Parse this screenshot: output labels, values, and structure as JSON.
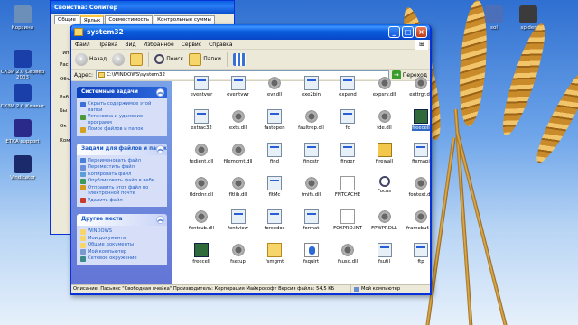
{
  "desktop": {
    "icons": [
      {
        "label": "Корзина",
        "icon": "recycle-bin-icon",
        "color": "#6b8fb9"
      },
      {
        "label": "СКЗИ 2.0 Сервер 2003",
        "icon": "app-icon",
        "color": "#1b3fa8"
      },
      {
        "label": "СКЗИ 2.0 Клиент",
        "icon": "app-icon",
        "color": "#1b3fa8"
      },
      {
        "label": "ЕТКА support",
        "icon": "app-icon",
        "color": "#2a2a8a"
      },
      {
        "label": "Vindicator",
        "icon": "app-icon",
        "color": "#1a2a6a"
      },
      {
        "label": "sol",
        "icon": "solitaire-icon",
        "color": "#4b6fb9"
      },
      {
        "label": "spider",
        "icon": "spider-icon",
        "color": "#3b3b3b"
      }
    ]
  },
  "props_window": {
    "title": "Свойства: Солитер",
    "tabs": [
      "Общие",
      "Ярлык",
      "Совместимость",
      "Контрольные суммы"
    ],
    "active_tab": 1,
    "labels": [
      "Тип",
      "Рас",
      "Объ",
      "Раб",
      "Бы",
      "Ок",
      "Ком"
    ]
  },
  "window": {
    "title": "system32",
    "menu": [
      "Файл",
      "Правка",
      "Вид",
      "Избранное",
      "Сервис",
      "Справка"
    ],
    "toolbar": {
      "back": "Назад",
      "search": "Поиск",
      "folders": "Папки"
    },
    "address_label": "Адрес:",
    "address_value": "C:\\WINDOWS\\system32",
    "go_label": "Переход"
  },
  "tasks": {
    "system": {
      "title": "Системные задачи",
      "items": [
        "Скрыть содержимое этой папки",
        "Установка и удаление программ",
        "Поиск файлов и папок"
      ]
    },
    "files": {
      "title": "Задачи для файлов и папок",
      "items": [
        "Переименовать файл",
        "Переместить файл",
        "Копировать файл",
        "Опубликовать файл в вебе",
        "Отправить этот файл по электронной почте",
        "Удалить файл"
      ]
    },
    "places": {
      "title": "Другие места",
      "items": [
        "WINDOWS",
        "Мои документы",
        "Общие документы",
        "Мой компьютер",
        "Сетевое окружение"
      ]
    }
  },
  "files": [
    {
      "name": "eventvwr",
      "icon": "exe"
    },
    {
      "name": "eventvwr",
      "icon": "exe"
    },
    {
      "name": "evr.dll",
      "icon": "gear"
    },
    {
      "name": "exe2bin",
      "icon": "exe"
    },
    {
      "name": "expand",
      "icon": "exe"
    },
    {
      "name": "expsrv.dll",
      "icon": "gear"
    },
    {
      "name": "exttrgr.dll",
      "icon": "gear"
    },
    {
      "name": "extrac32",
      "icon": "exe"
    },
    {
      "name": "exts.dll",
      "icon": "gear"
    },
    {
      "name": "fastopen",
      "icon": "exe"
    },
    {
      "name": "faultrep.dll",
      "icon": "gear"
    },
    {
      "name": "fc",
      "icon": "exe"
    },
    {
      "name": "fde.dll",
      "icon": "gear"
    },
    {
      "name": "freecell",
      "icon": "freecell"
    },
    {
      "name": "fedient.dll",
      "icon": "gear"
    },
    {
      "name": "filemgmt.dll",
      "icon": "gear"
    },
    {
      "name": "find",
      "icon": "exe"
    },
    {
      "name": "findstr",
      "icon": "exe"
    },
    {
      "name": "finger",
      "icon": "exe"
    },
    {
      "name": "firewall",
      "icon": "help"
    },
    {
      "name": "fixmapi",
      "icon": "exe"
    },
    {
      "name": "fldrclnr.dll",
      "icon": "gear"
    },
    {
      "name": "fltlib.dll",
      "icon": "gear"
    },
    {
      "name": "fltMc",
      "icon": "exe"
    },
    {
      "name": "fmifs.dll",
      "icon": "gear"
    },
    {
      "name": "FNTCACHE",
      "icon": "doc"
    },
    {
      "name": "Focus",
      "icon": "search"
    },
    {
      "name": "fontext.dll",
      "icon": "gear"
    },
    {
      "name": "fontsub.dll",
      "icon": "gear"
    },
    {
      "name": "fontview",
      "icon": "exe"
    },
    {
      "name": "forcedos",
      "icon": "exe"
    },
    {
      "name": "format",
      "icon": "exe"
    },
    {
      "name": "FOXPRO.INT",
      "icon": "doc"
    },
    {
      "name": "FPWPP.DLL",
      "icon": "gear"
    },
    {
      "name": "framebuf.dll",
      "icon": "gear"
    },
    {
      "name": "freecell",
      "icon": "freecell"
    },
    {
      "name": "fsetup",
      "icon": "gear"
    },
    {
      "name": "fsmgmt",
      "icon": "folder"
    },
    {
      "name": "fsquirt",
      "icon": "blue"
    },
    {
      "name": "fsusd.dll",
      "icon": "gear"
    },
    {
      "name": "fsutil",
      "icon": "exe"
    },
    {
      "name": "ftp",
      "icon": "exe"
    }
  ],
  "selected_file": "freecell",
  "statusbar": {
    "text": "Описание: Пасьянс \"Свободная ячейка\" Производитель: Корпорация Майкрософт Версия файла: 54,5 KБ",
    "location": "Мой компьютер"
  }
}
